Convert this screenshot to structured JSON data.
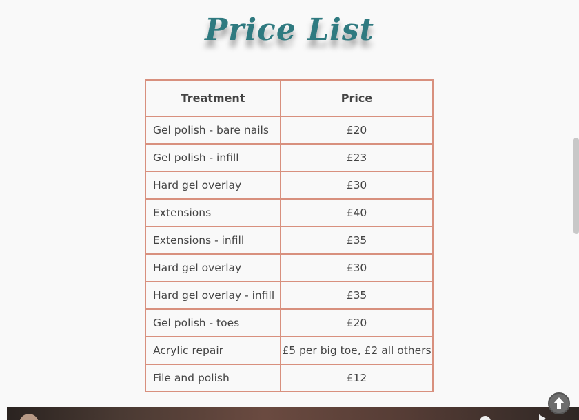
{
  "title": "Price List",
  "table": {
    "headers": [
      "Treatment",
      "Price"
    ],
    "rows": [
      {
        "treatment": "Gel polish - bare nails",
        "price": "£20"
      },
      {
        "treatment": "Gel polish - infill",
        "price": "£23"
      },
      {
        "treatment": "Hard gel overlay",
        "price": "£30"
      },
      {
        "treatment": "Extensions",
        "price": "£40"
      },
      {
        "treatment": "Extensions - infill",
        "price": "£35"
      },
      {
        "treatment": "Hard gel overlay",
        "price": "£30"
      },
      {
        "treatment": "Hard gel overlay - infill",
        "price": "£35"
      },
      {
        "treatment": "Gel polish - toes",
        "price": "£20"
      },
      {
        "treatment": "Acrylic repair",
        "price": "£5 per big toe, £2 all others"
      },
      {
        "treatment": "File and polish",
        "price": "£12"
      }
    ]
  },
  "colors": {
    "title": "#2f7a80",
    "table_border": "#d8907e",
    "text": "#444444"
  },
  "icons": {
    "back_to_top": "arrow-up-circle-icon",
    "video_info": "info-icon",
    "video_share": "share-icon"
  }
}
